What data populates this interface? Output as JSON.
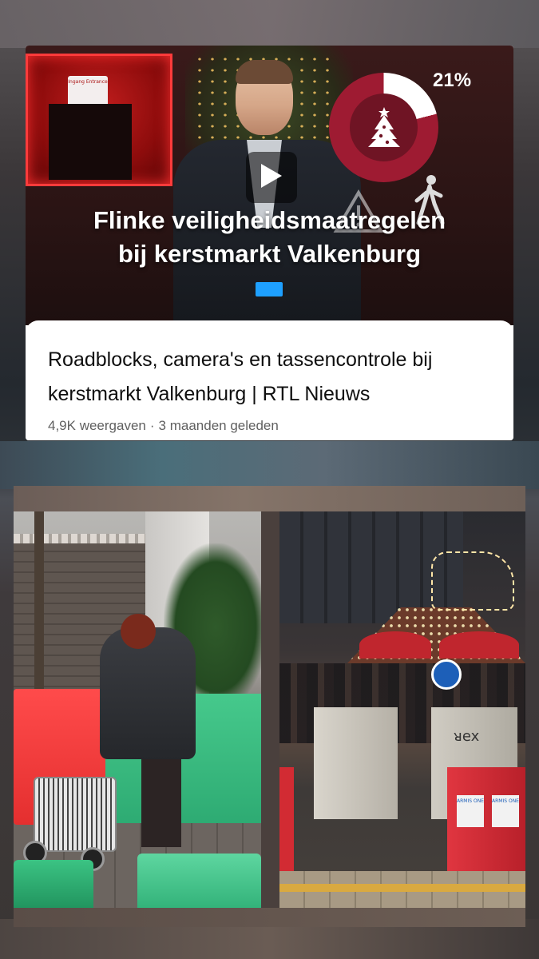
{
  "video": {
    "thumbnail": {
      "headline_line1": "Flinke veiligheidsmaatregelen",
      "headline_line2": "bij kerstmarkt Valkenburg",
      "stat_percent": "21%",
      "stat_share": 0.21,
      "entrance_sign": "Ingang Entrance",
      "accent_color": "#9e1b32",
      "mic_color": "#1ea0ff"
    },
    "play_icon": "play-icon",
    "title": "Roadblocks, camera's en tassencontrole bij kerstmarkt Valkenburg | RTL Nieuws",
    "views": "4,9K weergaven",
    "separator": "·",
    "age": "3 maanden geleden"
  },
  "photos": {
    "left": {
      "description_icon": "photo-concrete-blocks-woman"
    },
    "right": {
      "description_icon": "photo-christmas-market-barriers",
      "sign_text": "ARMIS ONE",
      "graffiti_text": "ᴚex"
    }
  }
}
